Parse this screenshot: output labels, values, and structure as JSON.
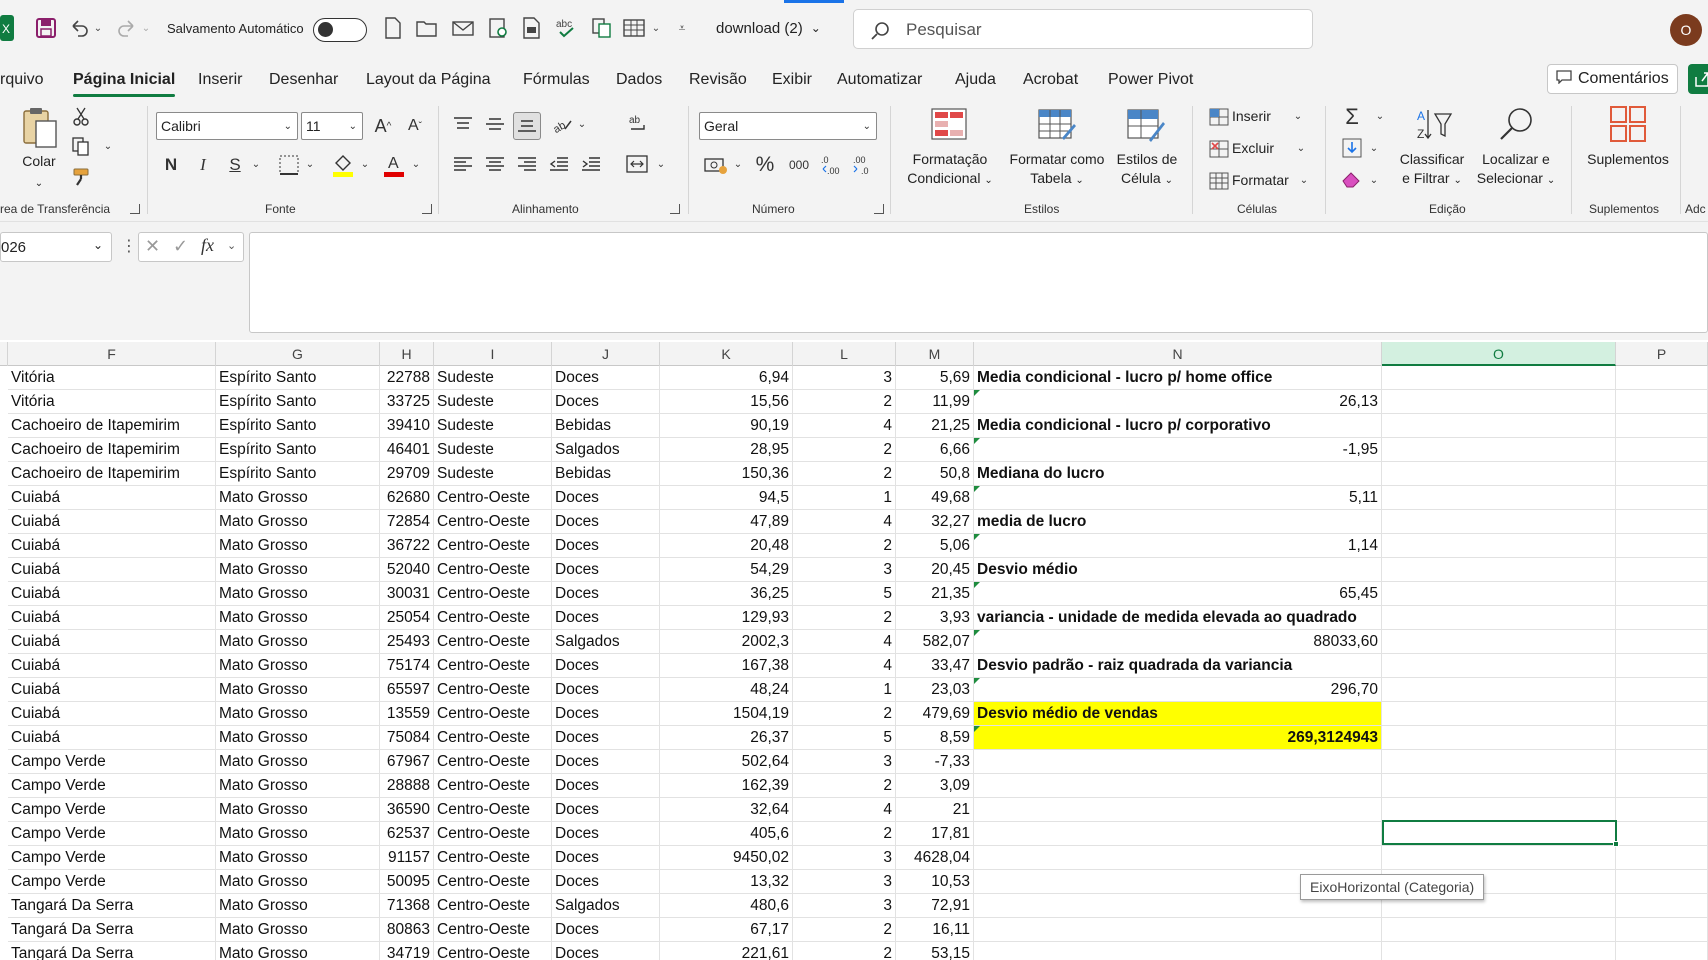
{
  "titlebar": {
    "autosave_label": "Salvamento Automático",
    "filename": "download (2)",
    "search_placeholder": "Pesquisar",
    "avatar_initial": "O"
  },
  "ribbon_tabs": [
    "rquivo",
    "Página Inicial",
    "Inserir",
    "Desenhar",
    "Layout da Página",
    "Fórmulas",
    "Dados",
    "Revisão",
    "Exibir",
    "Automatizar",
    "Ajuda",
    "Acrobat",
    "Power Pivot"
  ],
  "comments_label": "Comentários",
  "ribbon": {
    "clipboard": {
      "paste": "Colar",
      "group": "rea de Transferência"
    },
    "font": {
      "name": "Calibri",
      "size": "11",
      "bold": "N",
      "italic": "I",
      "underline": "S",
      "group": "Fonte"
    },
    "alignment": {
      "group": "Alinhamento"
    },
    "number": {
      "format": "Geral",
      "percent": "%",
      "thousands": "000",
      "group": "Número"
    },
    "styles": {
      "conditional": [
        "Formatação",
        "Condicional"
      ],
      "table": [
        "Formatar como",
        "Tabela"
      ],
      "cell": [
        "Estilos de",
        "Célula"
      ],
      "group": "Estilos"
    },
    "cells": {
      "insert": "Inserir",
      "delete": "Excluir",
      "format": "Formatar",
      "group": "Células"
    },
    "editing": {
      "sort": [
        "Classificar",
        "e Filtrar"
      ],
      "find": [
        "Localizar e",
        "Selecionar"
      ],
      "group": "Edição"
    },
    "addins": {
      "label": "Suplementos",
      "group": "Suplementos",
      "cut_group": "Adc"
    }
  },
  "namebox": "026",
  "colors": {
    "excel_green": "#107c41",
    "highlight": "#ffff00",
    "ribbon_bg": "#f3f3f3"
  },
  "columns": [
    "F",
    "G",
    "H",
    "I",
    "J",
    "K",
    "L",
    "M",
    "N",
    "O",
    "P"
  ],
  "rows": [
    [
      "Vitória",
      "Espírito Santo",
      "22788",
      "Sudeste",
      "Doces",
      "6,94",
      "3",
      "5,69",
      "Media condicional - lucro p/ home office"
    ],
    [
      "Vitória",
      "Espírito Santo",
      "33725",
      "Sudeste",
      "Doces",
      "15,56",
      "2",
      "11,99",
      "26,13"
    ],
    [
      "Cachoeiro de Itapemirim",
      "Espírito Santo",
      "39410",
      "Sudeste",
      "Bebidas",
      "90,19",
      "4",
      "21,25",
      "Media condicional - lucro p/ corporativo"
    ],
    [
      "Cachoeiro de Itapemirim",
      "Espírito Santo",
      "46401",
      "Sudeste",
      "Salgados",
      "28,95",
      "2",
      "6,66",
      "-1,95"
    ],
    [
      "Cachoeiro de Itapemirim",
      "Espírito Santo",
      "29709",
      "Sudeste",
      "Bebidas",
      "150,36",
      "2",
      "50,8",
      "Mediana do lucro"
    ],
    [
      "Cuiabá",
      "Mato Grosso",
      "62680",
      "Centro-Oeste",
      "Doces",
      "94,5",
      "1",
      "49,68",
      "5,11"
    ],
    [
      "Cuiabá",
      "Mato Grosso",
      "72854",
      "Centro-Oeste",
      "Doces",
      "47,89",
      "4",
      "32,27",
      "media de lucro"
    ],
    [
      "Cuiabá",
      "Mato Grosso",
      "36722",
      "Centro-Oeste",
      "Doces",
      "20,48",
      "2",
      "5,06",
      "1,14"
    ],
    [
      "Cuiabá",
      "Mato Grosso",
      "52040",
      "Centro-Oeste",
      "Doces",
      "54,29",
      "3",
      "20,45",
      "Desvio médio"
    ],
    [
      "Cuiabá",
      "Mato Grosso",
      "30031",
      "Centro-Oeste",
      "Doces",
      "36,25",
      "5",
      "21,35",
      "65,45"
    ],
    [
      "Cuiabá",
      "Mato Grosso",
      "25054",
      "Centro-Oeste",
      "Doces",
      "129,93",
      "2",
      "3,93",
      "variancia - unidade de medida elevada ao quadrado"
    ],
    [
      "Cuiabá",
      "Mato Grosso",
      "25493",
      "Centro-Oeste",
      "Salgados",
      "2002,3",
      "4",
      "582,07",
      "88033,60"
    ],
    [
      "Cuiabá",
      "Mato Grosso",
      "75174",
      "Centro-Oeste",
      "Doces",
      "167,38",
      "4",
      "33,47",
      "Desvio padrão - raiz quadrada da variancia"
    ],
    [
      "Cuiabá",
      "Mato Grosso",
      "65597",
      "Centro-Oeste",
      "Doces",
      "48,24",
      "1",
      "23,03",
      "296,70"
    ],
    [
      "Cuiabá",
      "Mato Grosso",
      "13559",
      "Centro-Oeste",
      "Doces",
      "1504,19",
      "2",
      "479,69",
      "Desvio médio de vendas"
    ],
    [
      "Cuiabá",
      "Mato Grosso",
      "75084",
      "Centro-Oeste",
      "Doces",
      "26,37",
      "5",
      "8,59",
      "269,3124943"
    ],
    [
      "Campo Verde",
      "Mato Grosso",
      "67967",
      "Centro-Oeste",
      "Doces",
      "502,64",
      "3",
      "-7,33",
      ""
    ],
    [
      "Campo Verde",
      "Mato Grosso",
      "28888",
      "Centro-Oeste",
      "Doces",
      "162,39",
      "2",
      "3,09",
      ""
    ],
    [
      "Campo Verde",
      "Mato Grosso",
      "36590",
      "Centro-Oeste",
      "Doces",
      "32,64",
      "4",
      "21",
      ""
    ],
    [
      "Campo Verde",
      "Mato Grosso",
      "62537",
      "Centro-Oeste",
      "Doces",
      "405,6",
      "2",
      "17,81",
      ""
    ],
    [
      "Campo Verde",
      "Mato Grosso",
      "91157",
      "Centro-Oeste",
      "Doces",
      "9450,02",
      "3",
      "4628,04",
      ""
    ],
    [
      "Campo Verde",
      "Mato Grosso",
      "50095",
      "Centro-Oeste",
      "Doces",
      "13,32",
      "3",
      "10,53",
      ""
    ],
    [
      "Tangará Da Serra",
      "Mato Grosso",
      "71368",
      "Centro-Oeste",
      "Salgados",
      "480,6",
      "3",
      "72,91",
      ""
    ],
    [
      "Tangará Da Serra",
      "Mato Grosso",
      "80863",
      "Centro-Oeste",
      "Doces",
      "67,17",
      "2",
      "16,11",
      ""
    ],
    [
      "Tangará Da Serra",
      "Mato Grosso",
      "34719",
      "Centro-Oeste",
      "Doces",
      "221,61",
      "2",
      "53,15",
      ""
    ]
  ],
  "tooltip": "EixoHorizontal (Categoria)"
}
